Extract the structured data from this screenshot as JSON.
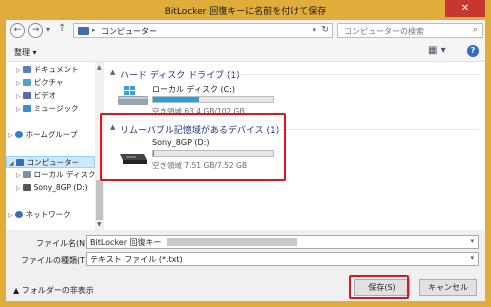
{
  "window": {
    "title": "BitLocker 回復キーに名前を付けて保存",
    "close_label": "✕"
  },
  "nav": {
    "back": "←",
    "forward": "→",
    "dropdown": "▾",
    "up": "↑",
    "address_separator": "▸",
    "address_text": "コンピューター",
    "address_dropdown": "▾",
    "refresh": "↻"
  },
  "search": {
    "placeholder": "コンピューターの検索",
    "icon": "⌕"
  },
  "toolbar": {
    "organize": "整理 ▾",
    "view_icon": "▦ ▾",
    "help": "?"
  },
  "sidebar": {
    "items": [
      {
        "label": "ドキュメント",
        "icon_color": "#5a7fb6"
      },
      {
        "label": "ピクチャ",
        "icon_color": "#4fa4c8"
      },
      {
        "label": "ビデオ",
        "icon_color": "#5b6bb0"
      },
      {
        "label": "ミュージック",
        "icon_color": "#3a8fd0"
      },
      {
        "label": "ホームグループ",
        "icon_color": "#2f7fc4"
      },
      {
        "label": "コンピューター",
        "icon_color": "#3d6fb0"
      },
      {
        "label": "ローカル ディスク (C",
        "icon_color": "#7a8fa8"
      },
      {
        "label": "Sony_8GP (D:)",
        "icon_color": "#555555"
      },
      {
        "label": "ネットワーク",
        "icon_color": "#3d6fb0"
      }
    ],
    "scroll_up": "▲",
    "scroll_down": "▼"
  },
  "content": {
    "group1": {
      "title": "ハード ディスク ドライブ (1)",
      "toggle": "▲"
    },
    "local_disk": {
      "name": "ローカル ディスク (C:)",
      "space": "空き領域 63.4 GB/102 GB",
      "used_fraction": 0.38
    },
    "group2": {
      "title": "リムーバブル記憶域があるデバイス (1)",
      "toggle": "▲"
    },
    "usb": {
      "name": "Sony_8GP (D:)",
      "space": "空き領域 7.51 GB/7.52 GB",
      "used_fraction": 0.002
    }
  },
  "bottom": {
    "filename_label": "ファイル名(N):",
    "filename_value": "BitLocker 回復キー",
    "filetype_label": "ファイルの種類(T):",
    "filetype_value": "テキスト ファイル (*.txt)",
    "hide_folders": "▲ フォルダーの非表示",
    "save": "保存(S)",
    "cancel": "キャンセル",
    "dropdown": "▾"
  },
  "colors": {
    "accent": "#e0ac3a",
    "highlight": "#e0141e",
    "bar_fill": "#26a0da",
    "group_title": "#1e3287"
  }
}
